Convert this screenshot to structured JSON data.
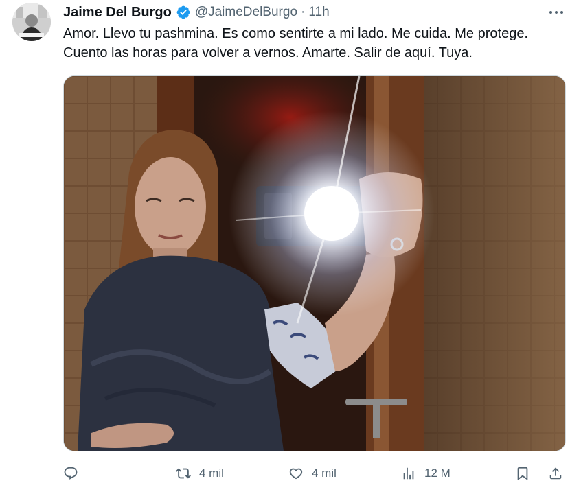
{
  "author": {
    "display_name": "Jaime Del Burgo",
    "handle": "@JaimeDelBurgo",
    "separator": "·",
    "time": "11h",
    "avatar_icon": "profile-photo",
    "verified_color": "#1d9bf0"
  },
  "tweet": {
    "text": "Amor. Llevo tu pashmina. Es como sentirte a mi lado. Me cuida. Me protege. Cuento las horas para volver a vernos. Amarte. Salir de aquí. Tuya.",
    "media_icon": "mirror-selfie-photo"
  },
  "actions": {
    "reply": {
      "icon": "reply-icon",
      "count": ""
    },
    "retweet": {
      "icon": "retweet-icon",
      "count": "4 mil"
    },
    "like": {
      "icon": "heart-icon",
      "count": "4 mil"
    },
    "views": {
      "icon": "views-icon",
      "count": "12 M"
    },
    "bookmark": {
      "icon": "bookmark-icon"
    },
    "share": {
      "icon": "share-icon"
    }
  },
  "colors": {
    "text": "#0f1419",
    "secondary": "#536471",
    "accent": "#1d9bf0"
  }
}
